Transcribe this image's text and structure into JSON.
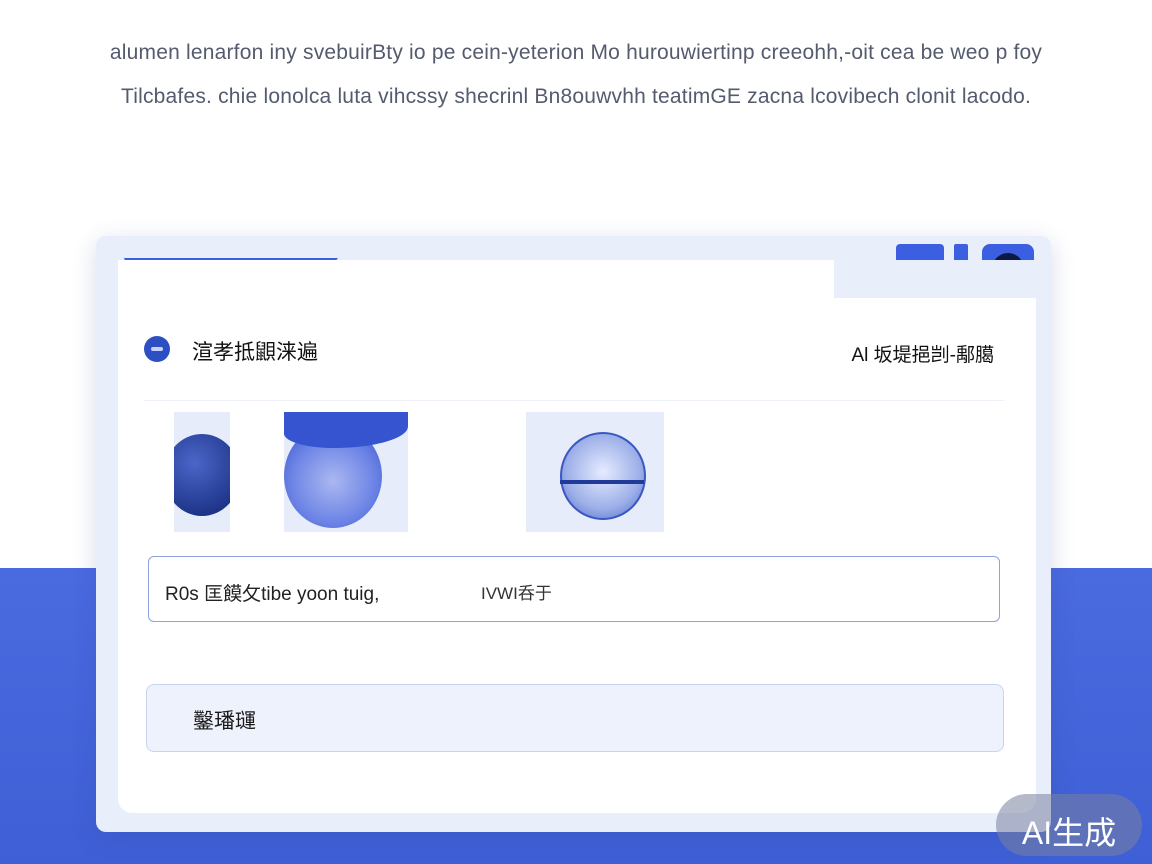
{
  "intro": {
    "line1": "alumen lenarfon iny svebuirBty io pe cein-yeterion Mo hurouwiertinp creeohh,-oit cea be weo p foy",
    "line2": "Tilcbafes. chie lonolca luta vihcssy shecrinl Bn8ouwvhh teatimGE zacna lcovibech clonit lacodo."
  },
  "window": {
    "app_title": "渲孝抵鼰涞遍",
    "header_right": "Al 坂堤挹剀-鄅臈",
    "input": {
      "left_text": "R0s 匡饃攵tibe yoon tuig,",
      "right_text": "IVWI呑于"
    },
    "action_label": "鑿璠璭"
  },
  "watermark": "AI生成",
  "colors": {
    "accent": "#3c5ee0",
    "band": "#4a6ae0",
    "window_bg": "#e9eefb"
  }
}
